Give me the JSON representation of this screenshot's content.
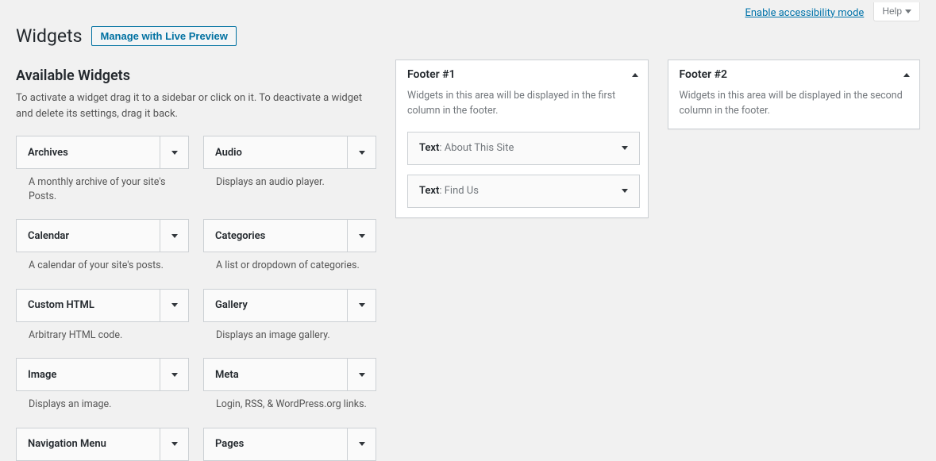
{
  "topbar": {
    "accessibility_link": "Enable accessibility mode",
    "help_label": "Help"
  },
  "heading": {
    "title": "Widgets",
    "live_preview_btn": "Manage with Live Preview"
  },
  "available": {
    "title": "Available Widgets",
    "description": "To activate a widget drag it to a sidebar or click on it. To deactivate a widget and delete its settings, drag it back."
  },
  "widgets": [
    {
      "name": "Archives",
      "desc": "A monthly archive of your site's Posts."
    },
    {
      "name": "Audio",
      "desc": "Displays an audio player."
    },
    {
      "name": "Calendar",
      "desc": "A calendar of your site's posts."
    },
    {
      "name": "Categories",
      "desc": "A list or dropdown of categories."
    },
    {
      "name": "Custom HTML",
      "desc": "Arbitrary HTML code."
    },
    {
      "name": "Gallery",
      "desc": "Displays an image gallery."
    },
    {
      "name": "Image",
      "desc": "Displays an image."
    },
    {
      "name": "Meta",
      "desc": "Login, RSS, & WordPress.org links."
    },
    {
      "name": "Navigation Menu",
      "desc": ""
    },
    {
      "name": "Pages",
      "desc": ""
    }
  ],
  "footer1": {
    "title": "Footer #1",
    "desc": "Widgets in this area will be displayed in the first column in the footer.",
    "items": [
      {
        "type": "Text",
        "title": "About This Site"
      },
      {
        "type": "Text",
        "title": "Find Us"
      }
    ]
  },
  "footer2": {
    "title": "Footer #2",
    "desc": "Widgets in this area will be displayed in the second column in the footer."
  }
}
